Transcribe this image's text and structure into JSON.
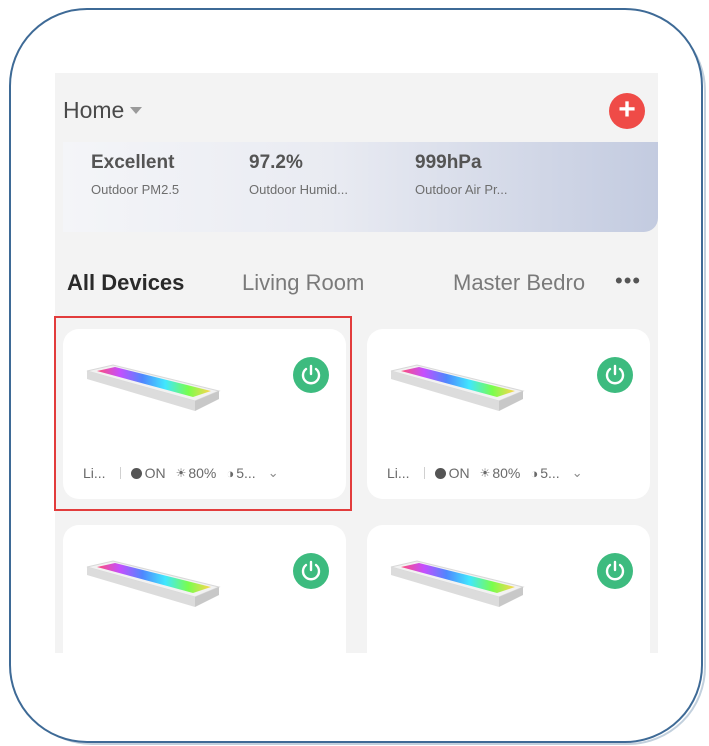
{
  "header": {
    "home_label": "Home"
  },
  "weather": [
    {
      "value": "Excellent",
      "label": "Outdoor PM2.5"
    },
    {
      "value": "97.2%",
      "label": "Outdoor Humid..."
    },
    {
      "value": "999hPa",
      "label": "Outdoor Air Pr..."
    }
  ],
  "tabs": [
    {
      "label": "All Devices",
      "active": true
    },
    {
      "label": "Living Room",
      "active": false
    },
    {
      "label": "Master Bedro",
      "active": false
    }
  ],
  "more_label": "•••",
  "devices": [
    {
      "name": "Li...",
      "power": "ON",
      "brightness": "80%",
      "extra": "5...",
      "powered": true
    },
    {
      "name": "Li...",
      "power": "ON",
      "brightness": "80%",
      "extra": "5...",
      "powered": true
    },
    {
      "name": "",
      "power": "",
      "brightness": "",
      "extra": "",
      "powered": true
    },
    {
      "name": "",
      "power": "",
      "brightness": "",
      "extra": "",
      "powered": true
    }
  ],
  "colors": {
    "accent_add": "#ef4b47",
    "power_on": "#3dbb7f",
    "highlight": "#e23c3c",
    "frame": "#3e6a96"
  }
}
